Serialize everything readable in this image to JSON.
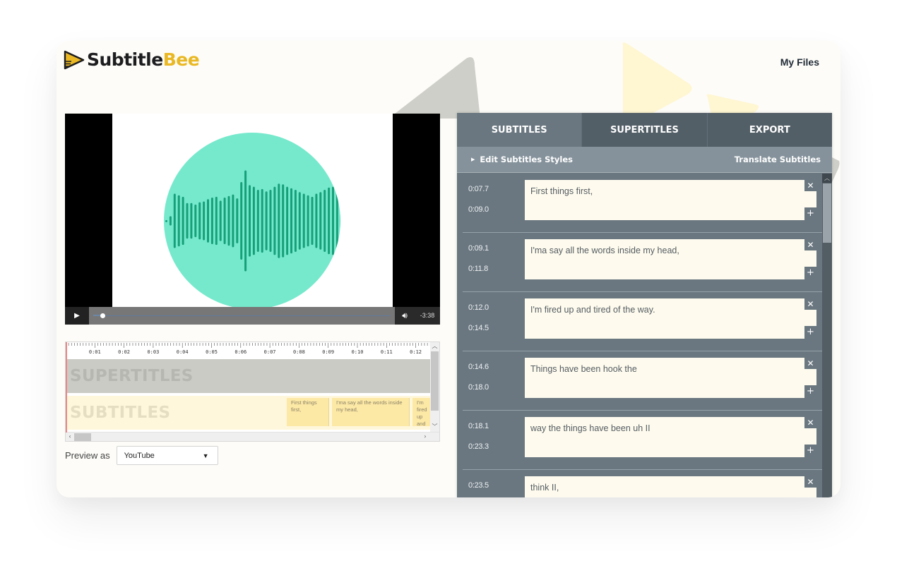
{
  "brand": {
    "name_part1": "Subtitle",
    "name_part2": "Bee",
    "accent": "#e9b824"
  },
  "nav": {
    "my_files": "My Files"
  },
  "video": {
    "play_icon": "play-icon",
    "volume_icon": "volume-icon",
    "time_remaining": "-3:38",
    "progress_fraction": 0.03
  },
  "timeline": {
    "ruler_labels": [
      "0:01",
      "0:02",
      "0:03",
      "0:04",
      "0:05",
      "0:06",
      "0:07",
      "0:08",
      "0:09",
      "0:10",
      "0:11",
      "0:12"
    ],
    "tracks": {
      "supertitles": "SUPERTITLES",
      "subtitles": "SUBTITLES"
    },
    "clips": [
      {
        "text": "First things first,"
      },
      {
        "text": "I'ma say all the words inside my head,"
      },
      {
        "text": "I'm fired up and tired of the way"
      }
    ]
  },
  "preview": {
    "label": "Preview as",
    "selected": "YouTube"
  },
  "panel": {
    "tabs": [
      {
        "label": "SUBTITLES",
        "active": true
      },
      {
        "label": "SUPERTITLES",
        "active": false
      },
      {
        "label": "EXPORT",
        "active": false
      }
    ],
    "edit_styles": "Edit Subtitles Styles",
    "translate": "Translate Subtitles",
    "subtitles": [
      {
        "start": "0:07.7",
        "end": "0:09.0",
        "text": "First things first,"
      },
      {
        "start": "0:09.1",
        "end": "0:11.8",
        "text": "I'ma say all the words inside my head,"
      },
      {
        "start": "0:12.0",
        "end": "0:14.5",
        "text": "I'm fired up and tired of the way."
      },
      {
        "start": "0:14.6",
        "end": "0:18.0",
        "text": "Things have been hook the"
      },
      {
        "start": "0:18.1",
        "end": "0:23.3",
        "text": "way the things have been uh II"
      },
      {
        "start": "0:23.5",
        "end": "",
        "text": "think II,"
      }
    ]
  }
}
